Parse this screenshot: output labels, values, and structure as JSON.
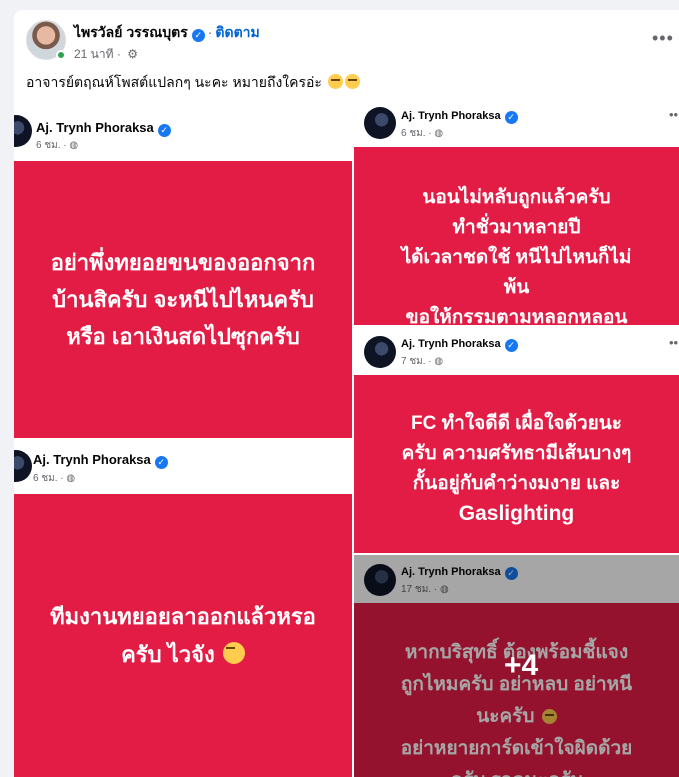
{
  "post": {
    "author": "ไพรวัลย์ วรรณบุตร",
    "follow_label": "ติดตาม",
    "time": "21 นาที",
    "caption": "อาจารย์ตฤณห์โพสต์แปลกๆ นะคะ หมายถึงใครอ่ะ",
    "caption_emoji": [
      "rolling-eyes-emoji",
      "rolling-eyes-emoji"
    ],
    "more_icon": "more-horizontal-icon"
  },
  "media": {
    "tiles": [
      {
        "name": "Aj. Trynh Phoraksa",
        "meta": "6 ชม. ·",
        "lines": [
          "อย่าพึ่งทยอยขนของออกจาก",
          "บ้านสิครับ จะหนีไปไหนครับ",
          "หรือ เอาเงินสดไปซุกครับ"
        ]
      },
      {
        "name": "Aj. Trynh Phoraksa",
        "meta": "6 ชม. ·",
        "lines": [
          "นอนไม่หลับถูกแล้วครับ",
          "ทำชั่วมาหลายปี",
          "ได้เวลาชดใช้ หนีไปไหนก็ไม่",
          "พ้น",
          "ขอให้กรรมตามหลอกหลอน"
        ]
      },
      {
        "name": "Aj. Trynh Phoraksa",
        "meta": "7 ชม. ·",
        "lines": [
          "FC ทำใจดีดี เผื่อใจด้วยนะ",
          "ครับ ความศรัทธามีเส้นบางๆ",
          "กั้นอยู่กับคำว่างมงาย และ",
          "Gaslighting"
        ]
      },
      {
        "name": "Aj. Trynh Phoraksa",
        "meta": "6 ชม. ·",
        "lines": [
          "ทีมงานทยอยลาออกแล้วหรอ",
          "ครับ ไวจัง"
        ]
      },
      {
        "name": "Aj. Trynh Phoraksa",
        "meta": "17 ชม. ·",
        "lines": [
          "หากบริสุทธิ์ ต้องพร้อมชี้แจง",
          "ถูกไหมครับ อย่าหลบ อย่าหนี",
          "นะครับ",
          "อย่าหยายการ์ดเข้าใจผิดด้วย",
          "ครับ รอดูนะครับ"
        ]
      }
    ],
    "more_count": "+4"
  }
}
